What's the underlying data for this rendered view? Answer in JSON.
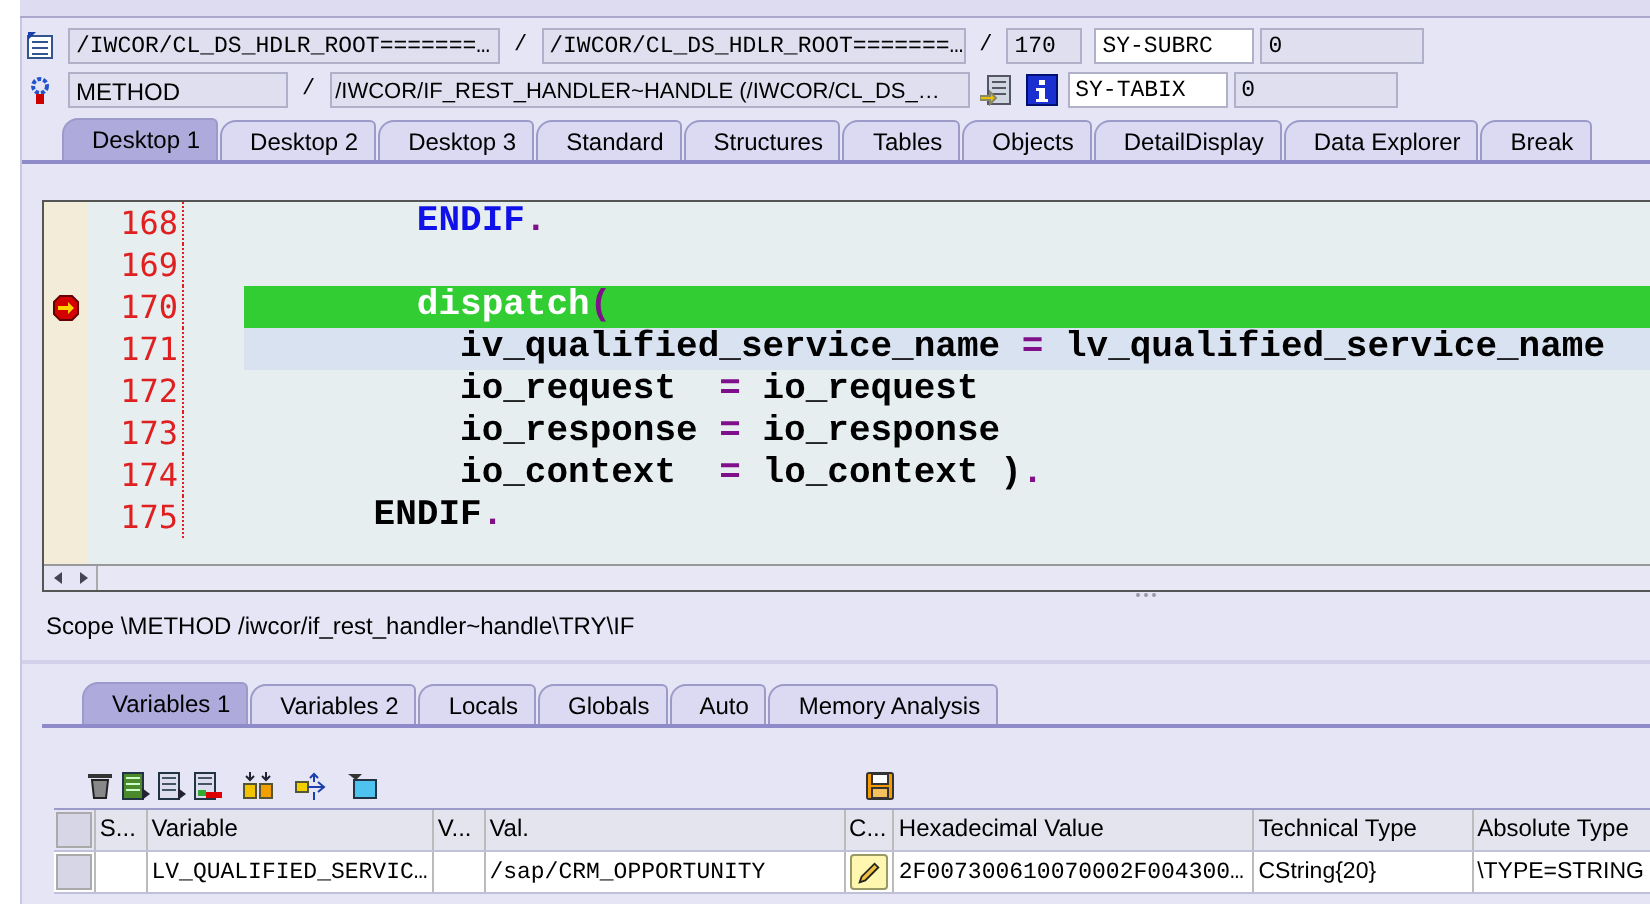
{
  "object_row": {
    "program": "/IWCOR/CL_DS_HDLR_ROOT=======…",
    "separator_1": "/",
    "include": "/IWCOR/CL_DS_HDLR_ROOT=======…",
    "separator_2": "/",
    "line": "170",
    "sysfield": {
      "name": "SY-SUBRC",
      "value": "0"
    }
  },
  "event_row": {
    "event_type": "METHOD",
    "separator": "/",
    "event": "/IWCOR/IF_REST_HANDLER~HANDLE (/IWCOR/CL_DS_…",
    "sysfield": {
      "name": "SY-TABIX",
      "value": "0"
    }
  },
  "desktop_tabs": [
    {
      "label": "Desktop 1",
      "selected": true
    },
    {
      "label": "Desktop 2",
      "selected": false
    },
    {
      "label": "Desktop 3",
      "selected": false
    },
    {
      "label": "Standard",
      "selected": false
    },
    {
      "label": "Structures",
      "selected": false
    },
    {
      "label": "Tables",
      "selected": false
    },
    {
      "label": "Objects",
      "selected": false
    },
    {
      "label": "DetailDisplay",
      "selected": false
    },
    {
      "label": "Data Explorer",
      "selected": false
    },
    {
      "label": "Break",
      "selected": false
    }
  ],
  "code_lines": [
    {
      "number": "168",
      "breakpoint": false,
      "current": false,
      "cursor": false,
      "tokens": [
        {
          "kind": "keyword",
          "text": "        ENDIF"
        },
        {
          "kind": "op",
          "text": "."
        }
      ]
    },
    {
      "number": "169",
      "breakpoint": false
    },
    {
      "number": "170",
      "breakpoint": true,
      "current": true,
      "cursor": false,
      "tokens": [
        {
          "kind": "text",
          "text": "        dispatch"
        },
        {
          "kind": "op",
          "text": "("
        }
      ]
    },
    {
      "number": "171",
      "breakpoint": false,
      "current": false,
      "cursor": true,
      "tokens": [
        {
          "kind": "text",
          "text": "          iv_qualified_service_name"
        },
        {
          "kind": "op",
          "text": " = "
        },
        {
          "kind": "text",
          "text": "lv_qualified_service_name"
        }
      ]
    },
    {
      "number": "172",
      "breakpoint": false,
      "current": false,
      "cursor": false,
      "tokens": [
        {
          "kind": "text",
          "text": "          io_request"
        },
        {
          "kind": "op",
          "text": "  = "
        },
        {
          "kind": "text",
          "text": "io_request"
        }
      ]
    },
    {
      "number": "173",
      "breakpoint": false,
      "current": false,
      "cursor": false,
      "tokens": [
        {
          "kind": "text",
          "text": "          io_response"
        },
        {
          "kind": "op",
          "text": " = "
        },
        {
          "kind": "text",
          "text": "io_response"
        }
      ]
    },
    {
      "number": "174",
      "breakpoint": false,
      "current": false,
      "cursor": false,
      "tokens": [
        {
          "kind": "text",
          "text": "          io_context"
        },
        {
          "kind": "op",
          "text": "  = "
        },
        {
          "kind": "text",
          "text": "lo_context )"
        },
        {
          "kind": "op",
          "text": "."
        }
      ]
    },
    {
      "number": "175",
      "breakpoint": false,
      "current": false,
      "cursor": false,
      "tokens": [
        {
          "kind": "text",
          "text": "      ENDIF"
        },
        {
          "kind": "op",
          "text": "."
        }
      ]
    }
  ],
  "scope": "Scope \\METHOD /iwcor/if_rest_handler~handle\\TRY\\IF",
  "variable_tabs": [
    {
      "label": "Variables 1",
      "selected": true
    },
    {
      "label": "Variables 2",
      "selected": false
    },
    {
      "label": "Locals",
      "selected": false
    },
    {
      "label": "Globals",
      "selected": false
    },
    {
      "label": "Auto",
      "selected": false
    },
    {
      "label": "Memory Analysis",
      "selected": false
    }
  ],
  "variables": {
    "columns": [
      "S...",
      "Variable",
      "V...",
      "Val.",
      "C...",
      "Hexadecimal Value",
      "Technical Type",
      "Absolute Type"
    ],
    "rows": [
      {
        "cells": [
          {
            "kind": "empty"
          },
          {
            "kind": "mono",
            "text": "LV_QUALIFIED_SERVIC…"
          },
          {
            "kind": "empty"
          },
          {
            "kind": "mono",
            "text": "/sap/CRM_OPPORTUNITY"
          },
          {
            "kind": "edit"
          },
          {
            "kind": "mono",
            "text": "2F007300610070002F004300…"
          },
          {
            "kind": "text",
            "text": "CString{20}"
          },
          {
            "kind": "text",
            "text": "\\TYPE=STRING"
          }
        ]
      }
    ]
  }
}
